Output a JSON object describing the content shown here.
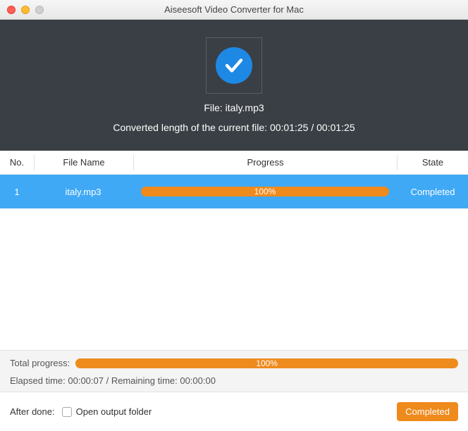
{
  "title": "Aiseesoft Video Converter for Mac",
  "hero": {
    "file_label": "File: italy.mp3",
    "converted_label": "Converted length of the current file: 00:01:25 / 00:01:25"
  },
  "columns": {
    "no": "No.",
    "file_name": "File Name",
    "progress": "Progress",
    "state": "State"
  },
  "rows": [
    {
      "no": "1",
      "name": "italy.mp3",
      "progress": "100%",
      "state": "Completed"
    }
  ],
  "footer": {
    "total_label": "Total progress:",
    "total_percent": "100%",
    "elapsed": "Elapsed time: 00:00:07 / Remaining time: 00:00:00",
    "after_done": "After done:",
    "open_folder_label": "Open output folder",
    "button": "Completed"
  }
}
